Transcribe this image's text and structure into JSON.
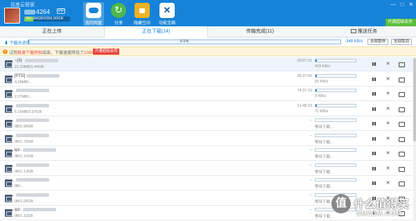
{
  "app": {
    "title": "百度云管家",
    "username_suffix": "4264",
    "vip_badge": "VIP",
    "quota_text": "391.84GB/2056.00GB",
    "quota_fraction": 0.19
  },
  "nav": {
    "tabs": [
      {
        "label": "我的网盘",
        "icon": "cloud-icon"
      },
      {
        "label": "分享",
        "icon": "share-icon"
      },
      {
        "label": "隐藏空间",
        "icon": "lock-icon"
      },
      {
        "label": "功能宝箱",
        "icon": "tools-icon"
      }
    ],
    "active": 0
  },
  "window": {
    "minimize": "—",
    "maximize": "□",
    "close": "✕",
    "open_vip": "开通超级会员"
  },
  "subtabs": {
    "uploading": "正在上传",
    "downloading": "正在下载(14)",
    "completed": "传输完成(11)",
    "push": "推送任务"
  },
  "total": {
    "label": "下载总进度",
    "percent_text": "0.1%",
    "fraction": 0.001,
    "speed": "348 KB/s",
    "pause_all": "全部暂停",
    "cancel_all": "全部取消"
  },
  "notice": {
    "icon": "!",
    "prefix": "试用",
    "highlight1": "极速下载特权",
    "middle": "结束，下载速度降低了",
    "highlight2": "100%！",
    "button": "开通超级会员"
  },
  "colors": {
    "header_bg": "#1683d8",
    "accent": "#2a8be0",
    "alert": "#e8453c",
    "notice_bg": "#fdf5dd"
  },
  "downloads": [
    {
      "name": "~(3) ",
      "size": "21.20MB/1.44GB",
      "time": "00:07:21",
      "speed": "418 KB/s",
      "progress": 0.015
    },
    {
      "name": "[PTD]",
      "size": "4.28MB/...",
      "time": "06:37:50",
      "speed": "55 KB/s",
      "progress": 0.005
    },
    {
      "name": "",
      "size": "2.27MB/...",
      "time": "74:37:19",
      "speed": "3 KB/s",
      "progress": 0.003
    },
    {
      "name": "",
      "size": "5.16MB/2.97GB",
      "time": "11:48:23",
      "speed": "71 KB/s",
      "progress": 0.002
    },
    {
      "name": "",
      "size": "0B/2.99GB",
      "time": "--",
      "speed": "等待下载...",
      "progress": 0
    },
    {
      "name": "",
      "size": "0B/1.73GB",
      "time": "--",
      "speed": "等待下载...",
      "progress": 0
    },
    {
      "name": "ipz-",
      "size": "0B/1.12GB",
      "time": "--",
      "speed": "等待下载...",
      "progress": 0
    },
    {
      "name": "",
      "size": "0B/1.13GB",
      "time": "--",
      "speed": "等待下载...",
      "progress": 0
    },
    {
      "name": "",
      "size": "0B/...",
      "time": "--",
      "speed": "等待下载...",
      "progress": 0
    },
    {
      "name": "",
      "size": "0B/1.00GB",
      "time": "--",
      "speed": "等待下载...",
      "progress": 0
    },
    {
      "name": "ipz-",
      "size": "0B/1.11GB",
      "time": "--",
      "speed": "等待下载...",
      "progress": 0
    }
  ],
  "watermark": {
    "logo": "值",
    "text": "什么值得买",
    "sub": "SMZDM.COM"
  }
}
